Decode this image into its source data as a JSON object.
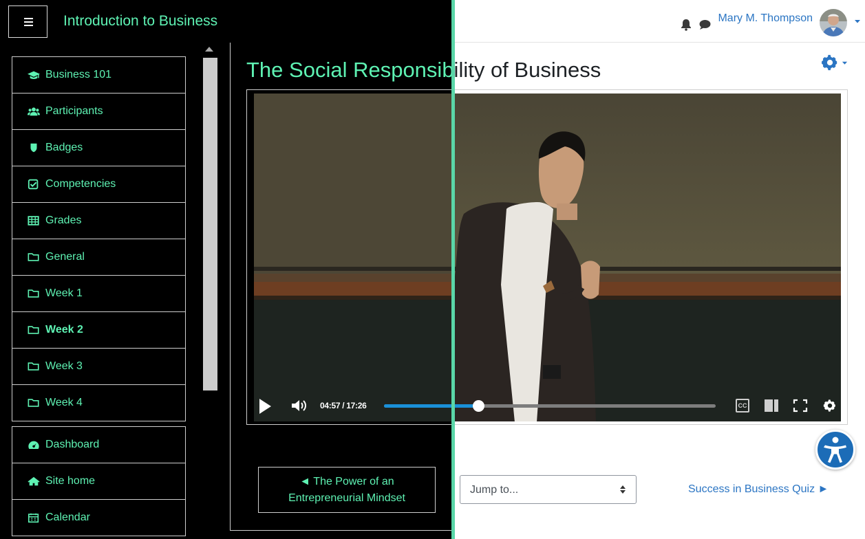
{
  "header": {
    "course_title": "Introduction to Business",
    "user_name": "Mary M. Thompson",
    "icons": [
      "hamburger-icon",
      "bell-icon",
      "chat-icon",
      "avatar",
      "caret-down-icon"
    ]
  },
  "sidebar": {
    "items": [
      {
        "label": "Business 101",
        "icon": "graduation-cap-icon"
      },
      {
        "label": "Participants",
        "icon": "users-icon"
      },
      {
        "label": "Badges",
        "icon": "shield-icon"
      },
      {
        "label": "Competencies",
        "icon": "check-square-icon"
      },
      {
        "label": "Grades",
        "icon": "table-icon"
      },
      {
        "label": "General",
        "icon": "folder-icon"
      },
      {
        "label": "Week 1",
        "icon": "folder-icon"
      },
      {
        "label": "Week 2",
        "icon": "folder-icon"
      },
      {
        "label": "Week 3",
        "icon": "folder-icon"
      },
      {
        "label": "Week 4",
        "icon": "folder-icon"
      }
    ],
    "footer_items": [
      {
        "label": "Dashboard",
        "icon": "tachometer-icon"
      },
      {
        "label": "Site home",
        "icon": "home-icon"
      },
      {
        "label": "Calendar",
        "icon": "calendar-icon"
      }
    ]
  },
  "main": {
    "page_title": "The Social Responsibility of Business",
    "prev_link": {
      "line1": "◄ The Power of an",
      "line2": "Entrepreneurial Mindset"
    },
    "jump_select": {
      "placeholder": "Jump to..."
    },
    "next_link": "Success in Business Quiz ►"
  },
  "video": {
    "current_time": "04:57",
    "duration": "17:26",
    "time_display": "04:57 / 17:26",
    "progress_fraction": 0.284,
    "cc_label": "CC",
    "controls": [
      "play-icon",
      "volume-icon",
      "cc-icon",
      "side-panel-icon",
      "fullscreen-icon",
      "settings-icon"
    ]
  },
  "colors": {
    "contrast_accent": "#5ef2b3",
    "link_blue": "#2b75c3",
    "progress_blue": "#1a90d8",
    "split_line": "#5ad6a8",
    "a11y_button": "#1c6cb7"
  }
}
